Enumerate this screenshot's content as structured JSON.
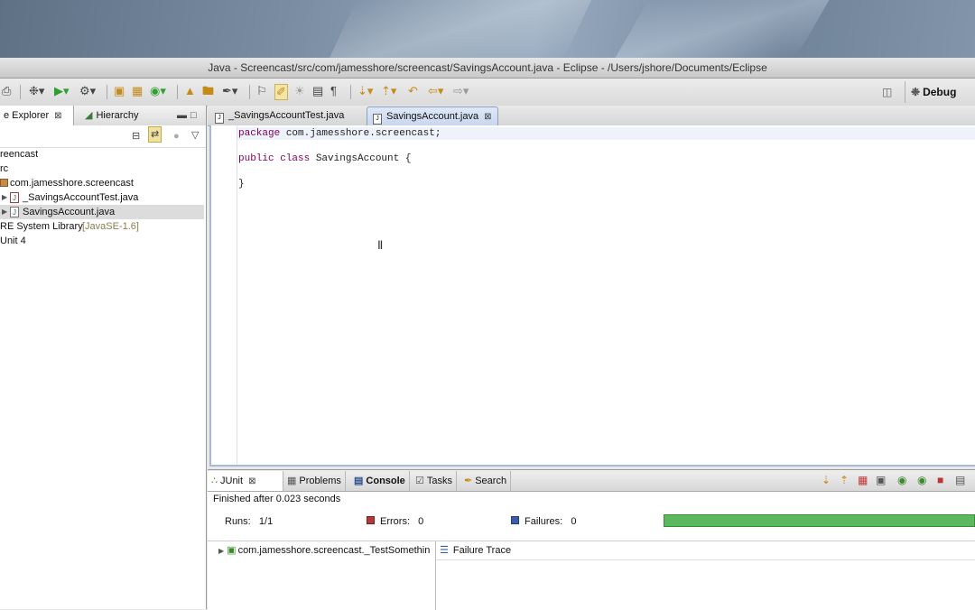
{
  "window": {
    "title": "Java - Screencast/src/com/jamesshore/screencast/SavingsAccount.java - Eclipse - /Users/jshore/Documents/Eclipse",
    "perspective": "Debug"
  },
  "left_panel": {
    "tabs": [
      {
        "label": "e Explorer"
      },
      {
        "label": "Hierarchy"
      }
    ],
    "tree": [
      {
        "label": "reencast"
      },
      {
        "label": "rc"
      },
      {
        "label": "com.jamesshore.screencast"
      },
      {
        "label": "_SavingsAccountTest.java"
      },
      {
        "label": "SavingsAccount.java"
      },
      {
        "label": "RE System Library",
        "suffix": "[JavaSE-1.6]"
      },
      {
        "label": "Unit 4"
      }
    ]
  },
  "editor": {
    "tabs": [
      {
        "label": "_SavingsAccountTest.java"
      },
      {
        "label": "SavingsAccount.java"
      }
    ],
    "code": [
      {
        "kw": "package",
        "rest": " com.jamesshore.screencast;"
      },
      {
        "kw": "public class",
        "rest": " SavingsAccount {"
      },
      {
        "kw": "",
        "rest": "}"
      }
    ]
  },
  "bottom_panel": {
    "tabs": [
      {
        "label": "JUnit"
      },
      {
        "label": "Problems"
      },
      {
        "label": "Console"
      },
      {
        "label": "Tasks"
      },
      {
        "label": "Search"
      }
    ],
    "status": "Finished after 0.023 seconds",
    "runs_label": "Runs:",
    "runs_value": "1/1",
    "errors_label": "Errors:",
    "errors_value": "0",
    "failures_label": "Failures:",
    "failures_value": "0",
    "progress_fraction": 1.0,
    "result_item": "com.jamesshore.screencast._TestSomethin",
    "failure_trace_label": "Failure Trace"
  },
  "colors": {
    "progress_success": "#5cb85c",
    "keyword": "#7f0055",
    "error_marker": "#b03a3a",
    "failure_marker": "#3b5ea8"
  }
}
